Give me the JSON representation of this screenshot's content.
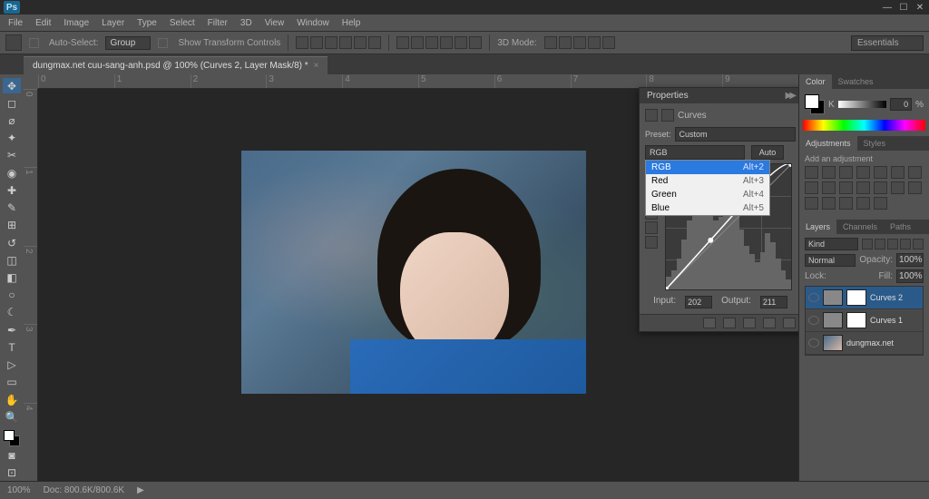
{
  "app": {
    "logo": "Ps"
  },
  "menu": [
    "File",
    "Edit",
    "Image",
    "Layer",
    "Type",
    "Select",
    "Filter",
    "3D",
    "View",
    "Window",
    "Help"
  ],
  "options": {
    "auto_select_label": "Auto-Select:",
    "auto_select_value": "Group",
    "show_transform": "Show Transform Controls",
    "mode_3d": "3D Mode:",
    "workspace": "Essentials"
  },
  "document": {
    "tab_title": "dungmax.net cuu-sang-anh.psd @ 100% (Curves 2, Layer Mask/8) *",
    "zoom": "100%",
    "doc_size": "Doc: 800.6K/800.6K"
  },
  "ruler_h": [
    "0",
    "1",
    "2",
    "3",
    "4",
    "5",
    "6",
    "7",
    "8",
    "9"
  ],
  "ruler_v": [
    "0",
    "1",
    "2",
    "3",
    "4"
  ],
  "properties": {
    "title": "Properties",
    "adj_label": "Curves",
    "preset_label": "Preset:",
    "preset_value": "Custom",
    "channel_value": "RGB",
    "auto": "Auto",
    "channel_options": [
      {
        "label": "RGB",
        "shortcut": "Alt+2",
        "selected": true
      },
      {
        "label": "Red",
        "shortcut": "Alt+3"
      },
      {
        "label": "Green",
        "shortcut": "Alt+4"
      },
      {
        "label": "Blue",
        "shortcut": "Alt+5"
      }
    ],
    "input_label": "Input:",
    "input_value": "202",
    "output_label": "Output:",
    "output_value": "211"
  },
  "color_panel": {
    "tab1": "Color",
    "tab2": "Swatches",
    "k_label": "K",
    "k_value": "0",
    "pct": "%"
  },
  "adjustments": {
    "tab1": "Adjustments",
    "tab2": "Styles",
    "heading": "Add an adjustment"
  },
  "layers": {
    "tabs": [
      "Layers",
      "Channels",
      "Paths"
    ],
    "kind": "Kind",
    "blend": "Normal",
    "opacity_label": "Opacity:",
    "opacity_value": "100%",
    "lock_label": "Lock:",
    "fill_label": "Fill:",
    "fill_value": "100%",
    "items": [
      {
        "name": "Curves 2",
        "selected": true,
        "has_mask": true
      },
      {
        "name": "Curves 1",
        "selected": false,
        "has_mask": true
      },
      {
        "name": "dungmax.net",
        "selected": false,
        "has_mask": false
      }
    ]
  },
  "colors": {
    "accent": "#2a7ae0",
    "panel": "#535353",
    "dark": "#3a3a3a"
  }
}
